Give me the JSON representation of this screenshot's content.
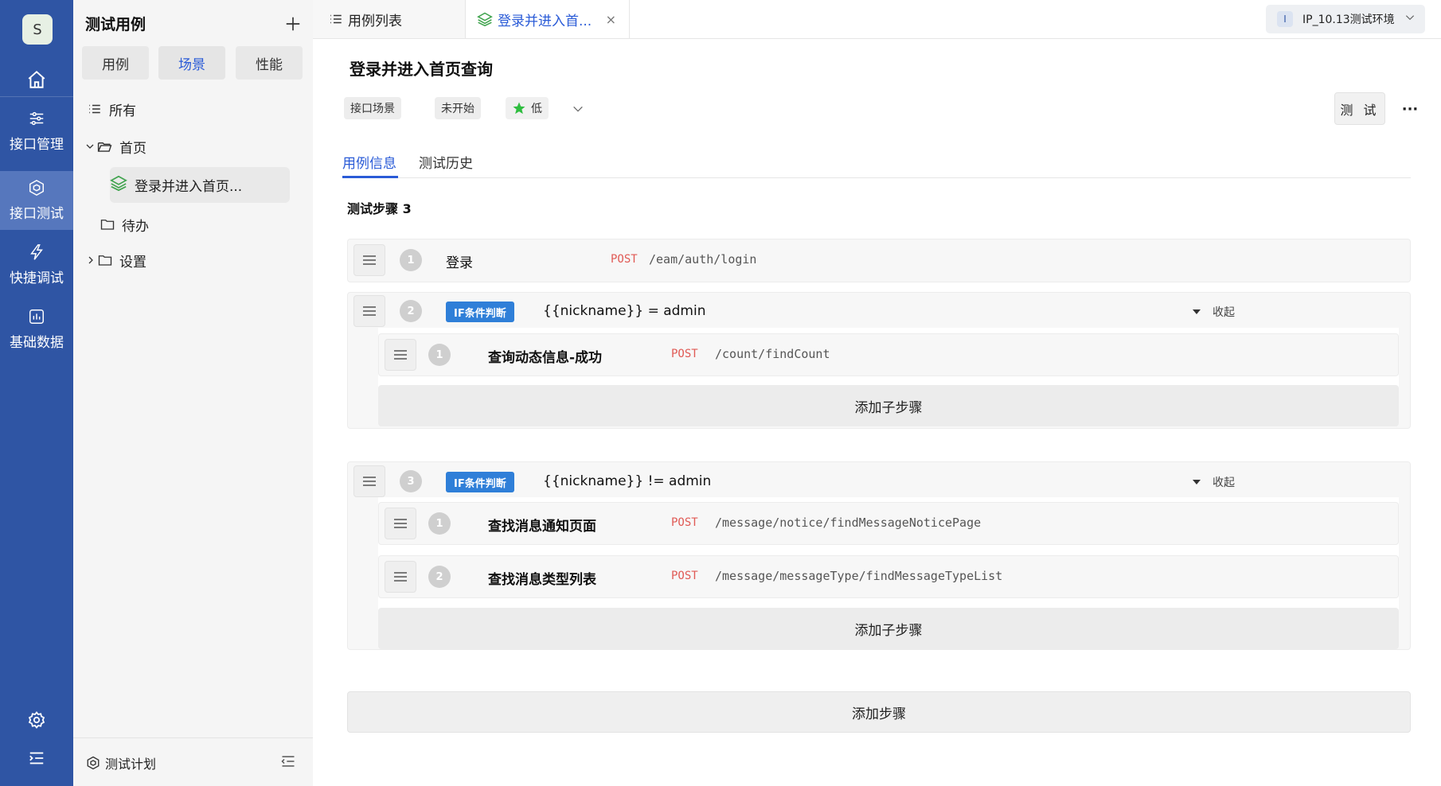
{
  "rail": {
    "avatar": "S",
    "items": [
      {
        "label": "接口管理",
        "icon": "sliders-icon"
      },
      {
        "label": "接口测试",
        "icon": "cube-icon"
      },
      {
        "label": "快捷调试",
        "icon": "lightning-icon"
      },
      {
        "label": "基础数据",
        "icon": "chart-icon"
      }
    ],
    "active_item": "接口测试"
  },
  "panel": {
    "title": "测试用例",
    "segments": [
      "用例",
      "场景",
      "性能"
    ],
    "active_segment": "场景",
    "tree": {
      "all": "所有",
      "home": "首页",
      "home_child": "登录并进入首页...",
      "todo": "待办",
      "settings": "设置"
    },
    "footer": "测试计划"
  },
  "tabs": {
    "list": "用例列表",
    "current": "登录并进入首...",
    "close": "×"
  },
  "env": {
    "badge": "I",
    "label": "IP_10.13测试环境"
  },
  "main": {
    "title": "登录并进入首页查询",
    "chips": {
      "type": "接口场景",
      "status": "未开始",
      "priority": "低"
    },
    "test_button": "测 试",
    "more": "···",
    "subtabs": [
      "用例信息",
      "测试历史"
    ],
    "active_subtab": "用例信息",
    "steps_title": "测试步骤 3",
    "steps": [
      {
        "no": "1",
        "name": "登录",
        "method": "POST",
        "path": "/eam/auth/login"
      },
      {
        "no": "2",
        "tag": "IF条件判断",
        "condition": "{{nickname}} = admin",
        "collapse": "收起",
        "children": [
          {
            "no": "1",
            "name": "查询动态信息-成功",
            "method": "POST",
            "path": "/count/findCount"
          }
        ],
        "add_child": "添加子步骤"
      },
      {
        "no": "3",
        "tag": "IF条件判断",
        "condition": "{{nickname}} != admin",
        "collapse": "收起",
        "children": [
          {
            "no": "1",
            "name": "查找消息通知页面",
            "method": "POST",
            "path": "/message/notice/findMessageNoticePage"
          },
          {
            "no": "2",
            "name": "查找消息类型列表",
            "method": "POST",
            "path": "/message/messageType/findMessageTypeList"
          }
        ],
        "add_child": "添加子步骤"
      }
    ],
    "add_step": "添加步骤"
  },
  "colors": {
    "rail_bg": "#2f55a4",
    "accent": "#2a5bd7",
    "method_post": "#e05a55",
    "if_tag": "#2f7fd8"
  }
}
